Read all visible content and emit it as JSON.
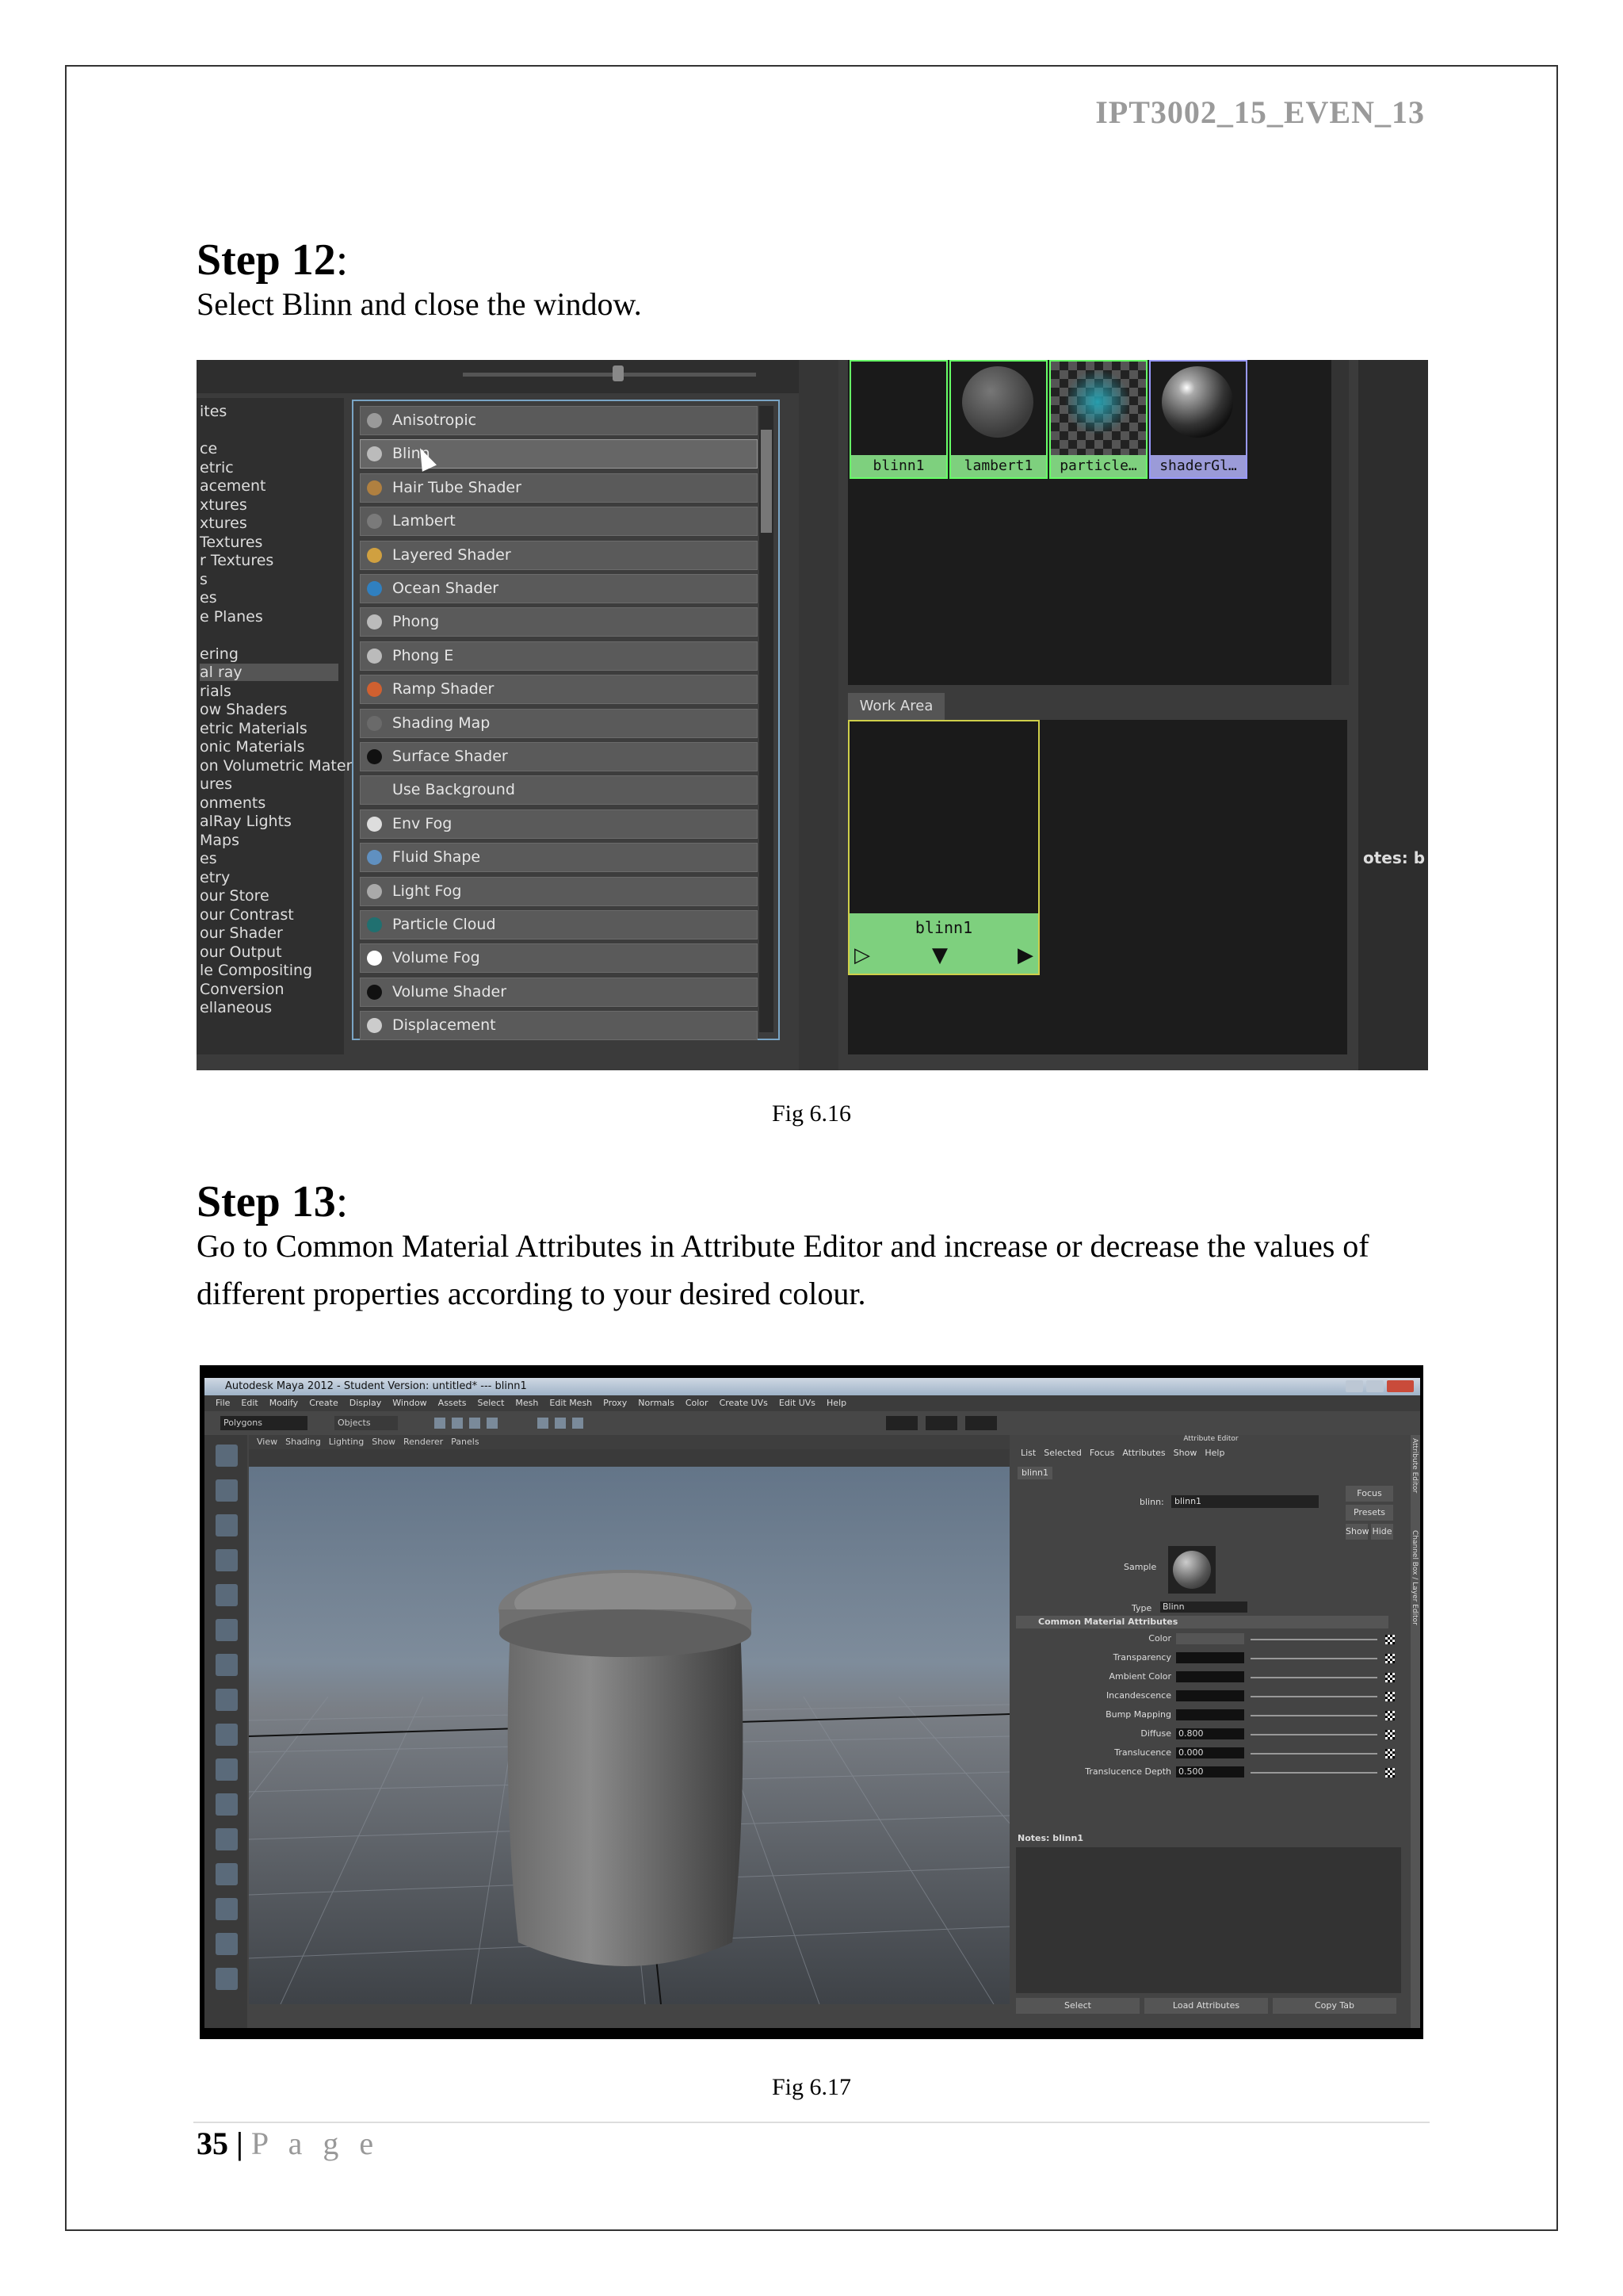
{
  "header": {
    "code": "IPT3002_15_EVEN_13"
  },
  "step12": {
    "title": "Step 12",
    "colon": ":",
    "text": "Select Blinn and close the window."
  },
  "fig616": {
    "caption": "Fig 6.16",
    "categories": [
      "ites",
      "",
      "ce",
      "etric",
      "acement",
      "xtures",
      "xtures",
      "Textures",
      "r Textures",
      "s",
      "es",
      "e Planes",
      "",
      "ering",
      "al ray",
      "rials",
      "ow Shaders",
      "etric Materials",
      "onic Materials",
      "on Volumetric Materi...",
      "ures",
      "onments",
      "alRay Lights",
      "Maps",
      "es",
      "etry",
      "our Store",
      "our Contrast",
      "our Shader",
      "our Output",
      "le Compositing",
      "Conversion",
      "ellaneous"
    ],
    "shaders": [
      {
        "label": "Anisotropic",
        "icon_color": "#9a9a9a"
      },
      {
        "label": "Blinn",
        "icon_color": "#bbbbbb",
        "selected": true
      },
      {
        "label": "Hair Tube Shader",
        "icon_color": "#b08040"
      },
      {
        "label": "Lambert",
        "icon_color": "#7a7a7a"
      },
      {
        "label": "Layered Shader",
        "icon_color": "#d0a040"
      },
      {
        "label": "Ocean Shader",
        "icon_color": "#3080c0"
      },
      {
        "label": "Phong",
        "icon_color": "#bbbbbb"
      },
      {
        "label": "Phong E",
        "icon_color": "#bbbbbb"
      },
      {
        "label": "Ramp Shader",
        "icon_color": "#d06030"
      },
      {
        "label": "Shading Map",
        "icon_color": "#6a6a6a"
      },
      {
        "label": "Surface Shader",
        "icon_color": "#111111"
      },
      {
        "label": "Use Background",
        "icon_color": "#5a5a5a"
      },
      {
        "label": "Env Fog",
        "icon_color": "#dddddd"
      },
      {
        "label": "Fluid Shape",
        "icon_color": "#6090c0"
      },
      {
        "label": "Light Fog",
        "icon_color": "#aaaaaa"
      },
      {
        "label": "Particle Cloud",
        "icon_color": "#207070"
      },
      {
        "label": "Volume Fog",
        "icon_color": "#ffffff"
      },
      {
        "label": "Volume Shader",
        "icon_color": "#111111"
      },
      {
        "label": "Displacement",
        "icon_color": "#cccccc"
      }
    ],
    "swatches": [
      "blinn1",
      "lambert1",
      "particle…",
      "shaderGl…"
    ],
    "work_area_label": "Work Area",
    "node_label": "blinn1",
    "notes_partial": "otes: b"
  },
  "step13": {
    "title": "Step 13",
    "colon": ":",
    "text_line1": "Go to Common Material Attributes in Attribute Editor and increase or decrease the values of",
    "text_line2": "different properties according to your desired colour."
  },
  "fig617": {
    "caption": "Fig 6.17",
    "window_title": "Autodesk Maya 2012 - Student Version: untitled* --- blinn1",
    "menus": [
      "File",
      "Edit",
      "Modify",
      "Create",
      "Display",
      "Window",
      "Assets",
      "Select",
      "Mesh",
      "Edit Mesh",
      "Proxy",
      "Normals",
      "Color",
      "Create UVs",
      "Edit UVs",
      "Help"
    ],
    "mode": "Polygons",
    "objects": "Objects",
    "viewport_menus": [
      "View",
      "Shading",
      "Lighting",
      "Show",
      "Renderer",
      "Panels"
    ],
    "attr_title": "Attribute Editor",
    "attr_menus": [
      "List",
      "Selected",
      "Focus",
      "Attributes",
      "Show",
      "Help"
    ],
    "attr_tab": "blinn1",
    "blinn_label": "blinn:",
    "blinn_value": "blinn1",
    "focus": "Focus",
    "presets": "Presets",
    "show": "Show",
    "hide": "Hide",
    "sample": "Sample",
    "type_label": "Type",
    "type_value": "Blinn",
    "section": "Common Material Attributes",
    "attributes": [
      {
        "label": "Color",
        "value": ""
      },
      {
        "label": "Transparency",
        "value": ""
      },
      {
        "label": "Ambient Color",
        "value": ""
      },
      {
        "label": "Incandescence",
        "value": ""
      },
      {
        "label": "Bump Mapping",
        "value": ""
      },
      {
        "label": "Diffuse",
        "value": "0.800"
      },
      {
        "label": "Translucence",
        "value": "0.000"
      },
      {
        "label": "Translucence Depth",
        "value": "0.500"
      }
    ],
    "notes": "Notes: blinn1",
    "bottom_buttons": [
      "Select",
      "Load Attributes",
      "Copy Tab"
    ],
    "side_tabs": [
      "Attribute Editor",
      "Channel Box / Layer Editor"
    ]
  },
  "footer": {
    "page_number": "35",
    "separator": "|",
    "page_word": "P a g e"
  }
}
